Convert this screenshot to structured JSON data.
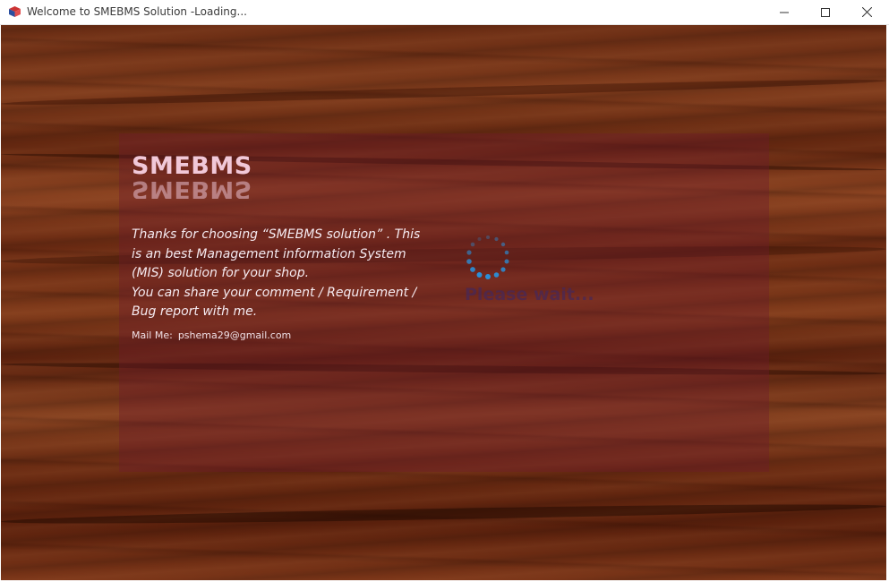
{
  "window": {
    "title": "Welcome to SMEBMS Solution -Loading...",
    "icon": "app-cube-icon",
    "controls": {
      "minimize": "minimize-icon",
      "maximize": "maximize-icon",
      "close": "close-icon"
    }
  },
  "splash": {
    "heading": "SMEBMS",
    "message_line1": "Thanks for choosing “SMEBMS  solution” . This is an best  Management information System (MIS) solution for your shop.",
    "message_line2": "You can share your comment / Requirement / Bug report with me.",
    "mail_label": "Mail Me:",
    "mail_address": "pshema29@gmail.com",
    "loading_text": "Please wait..."
  },
  "colors": {
    "wood_base": "#6b2d14",
    "panel_tint": "#6e192d",
    "heading": "#f1c8d8",
    "spinner": "#2a8fd8"
  }
}
